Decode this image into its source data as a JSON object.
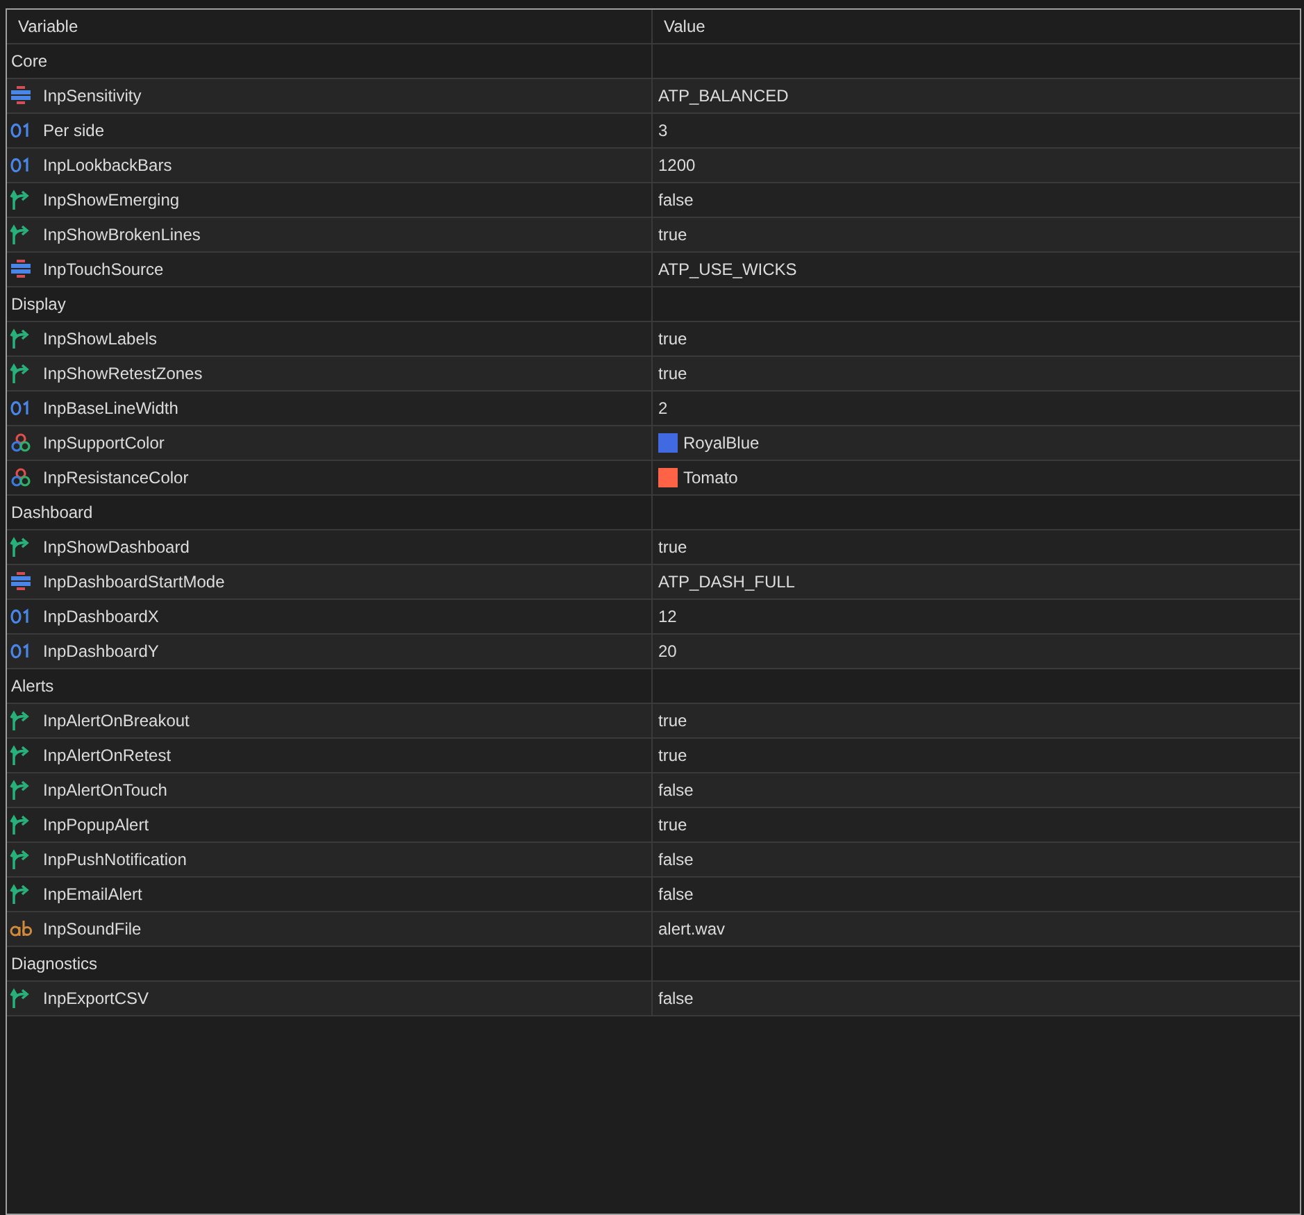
{
  "columns": [
    "Variable",
    "Value"
  ],
  "rows": [
    {
      "kind": "group",
      "label": "Core"
    },
    {
      "kind": "enum",
      "label": "InpSensitivity",
      "value": "ATP_BALANCED"
    },
    {
      "kind": "int",
      "label": "Per side",
      "value": "3"
    },
    {
      "kind": "int",
      "label": "InpLookbackBars",
      "value": "1200"
    },
    {
      "kind": "bool",
      "label": "InpShowEmerging",
      "value": "false"
    },
    {
      "kind": "bool",
      "label": "InpShowBrokenLines",
      "value": "true"
    },
    {
      "kind": "enum",
      "label": "InpTouchSource",
      "value": "ATP_USE_WICKS"
    },
    {
      "kind": "group",
      "label": "Display"
    },
    {
      "kind": "bool",
      "label": "InpShowLabels",
      "value": "true"
    },
    {
      "kind": "bool",
      "label": "InpShowRetestZones",
      "value": "true"
    },
    {
      "kind": "int",
      "label": "InpBaseLineWidth",
      "value": "2"
    },
    {
      "kind": "color",
      "label": "InpSupportColor",
      "value": "RoyalBlue",
      "color": "#4169e1"
    },
    {
      "kind": "color",
      "label": "InpResistanceColor",
      "value": "Tomato",
      "color": "#ff6347"
    },
    {
      "kind": "group",
      "label": "Dashboard"
    },
    {
      "kind": "bool",
      "label": "InpShowDashboard",
      "value": "true"
    },
    {
      "kind": "enum",
      "label": "InpDashboardStartMode",
      "value": "ATP_DASH_FULL"
    },
    {
      "kind": "int",
      "label": "InpDashboardX",
      "value": "12"
    },
    {
      "kind": "int",
      "label": "InpDashboardY",
      "value": "20"
    },
    {
      "kind": "group",
      "label": "Alerts"
    },
    {
      "kind": "bool",
      "label": "InpAlertOnBreakout",
      "value": "true"
    },
    {
      "kind": "bool",
      "label": "InpAlertOnRetest",
      "value": "true"
    },
    {
      "kind": "bool",
      "label": "InpAlertOnTouch",
      "value": "false"
    },
    {
      "kind": "bool",
      "label": "InpPopupAlert",
      "value": "true"
    },
    {
      "kind": "bool",
      "label": "InpPushNotification",
      "value": "false"
    },
    {
      "kind": "bool",
      "label": "InpEmailAlert",
      "value": "false"
    },
    {
      "kind": "string",
      "label": "InpSoundFile",
      "value": "alert.wav"
    },
    {
      "kind": "group",
      "label": "Diagnostics"
    },
    {
      "kind": "bool",
      "label": "InpExportCSV",
      "value": "false"
    }
  ]
}
